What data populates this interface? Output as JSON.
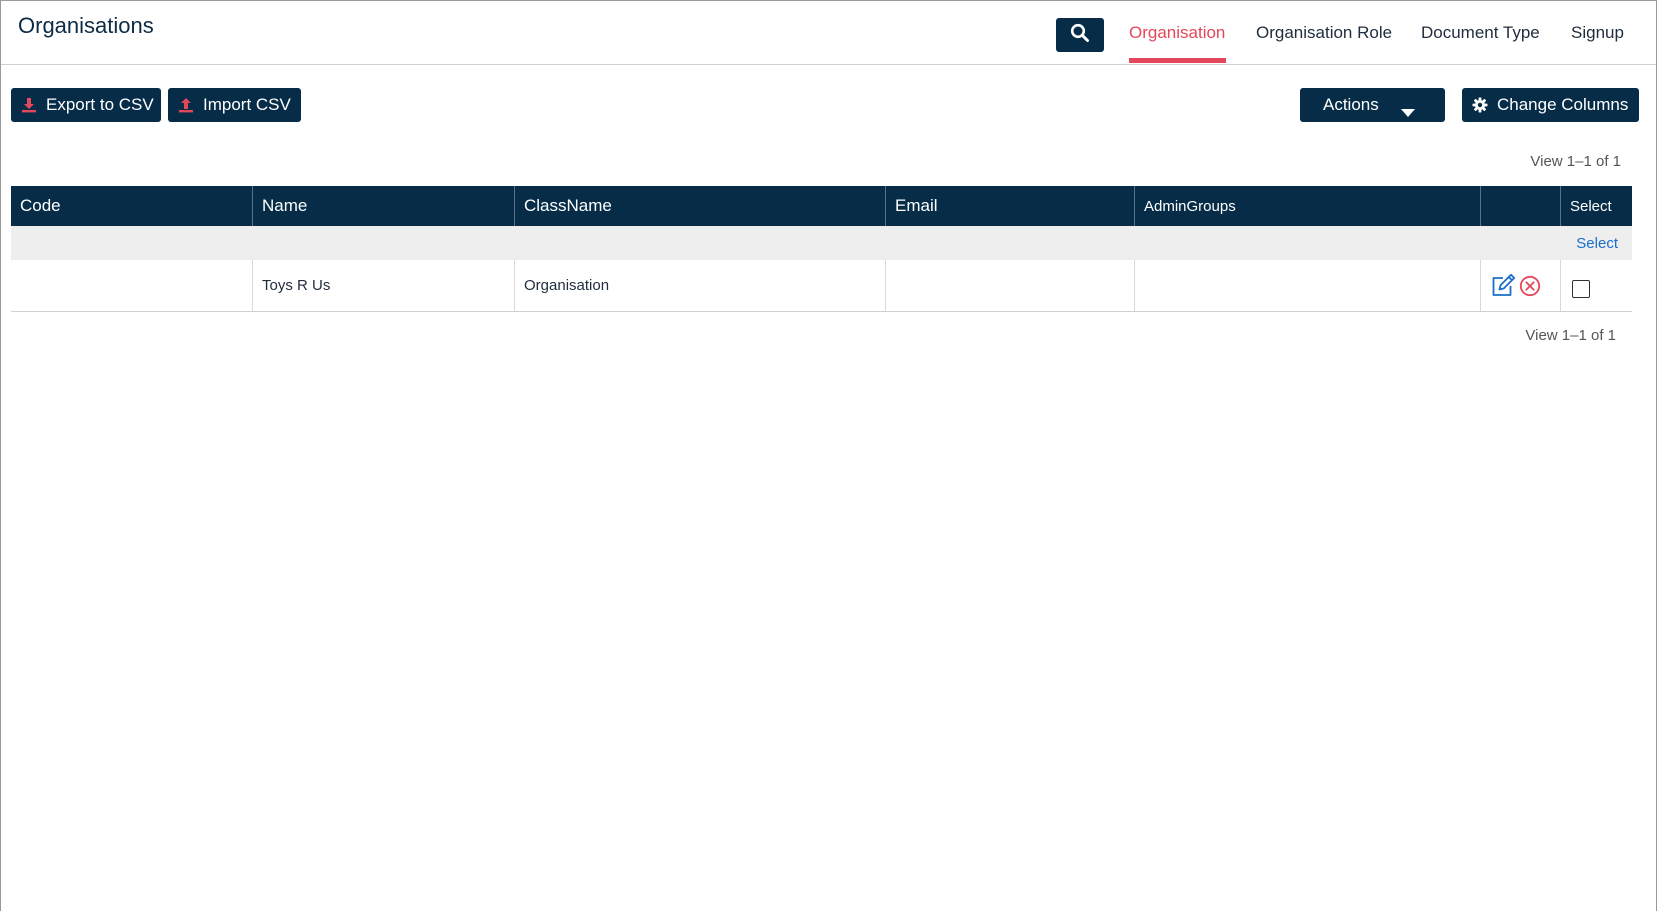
{
  "header": {
    "title": "Organisations",
    "nav": [
      {
        "label": "Organisation",
        "active": true
      },
      {
        "label": "Organisation Role",
        "active": false
      },
      {
        "label": "Document Type",
        "active": false
      },
      {
        "label": "Signup",
        "active": false
      }
    ]
  },
  "toolbar": {
    "export_label": "Export to CSV",
    "import_label": "Import CSV",
    "actions_label": "Actions",
    "columns_label": "Change Columns"
  },
  "pagination": {
    "top_text": "View 1–1 of 1",
    "bottom_text": "View 1–1 of 1"
  },
  "table": {
    "columns": [
      "Code",
      "Name",
      "ClassName",
      "Email",
      "AdminGroups",
      "",
      "Select"
    ],
    "filter_select_label": "Select",
    "rows": [
      {
        "code": "",
        "name": "Toys R Us",
        "classname": "Organisation",
        "email": "",
        "admingroups": "",
        "selected": false
      }
    ]
  },
  "colors": {
    "primary": "#062c48",
    "accent": "#e5475a",
    "link": "#1a6ec9"
  },
  "icons": {
    "search": "search-icon",
    "export": "download-icon",
    "import": "upload-icon",
    "actions": "caret-down-icon",
    "columns": "gear-icon",
    "edit": "edit-icon",
    "delete": "delete-circle-icon"
  }
}
